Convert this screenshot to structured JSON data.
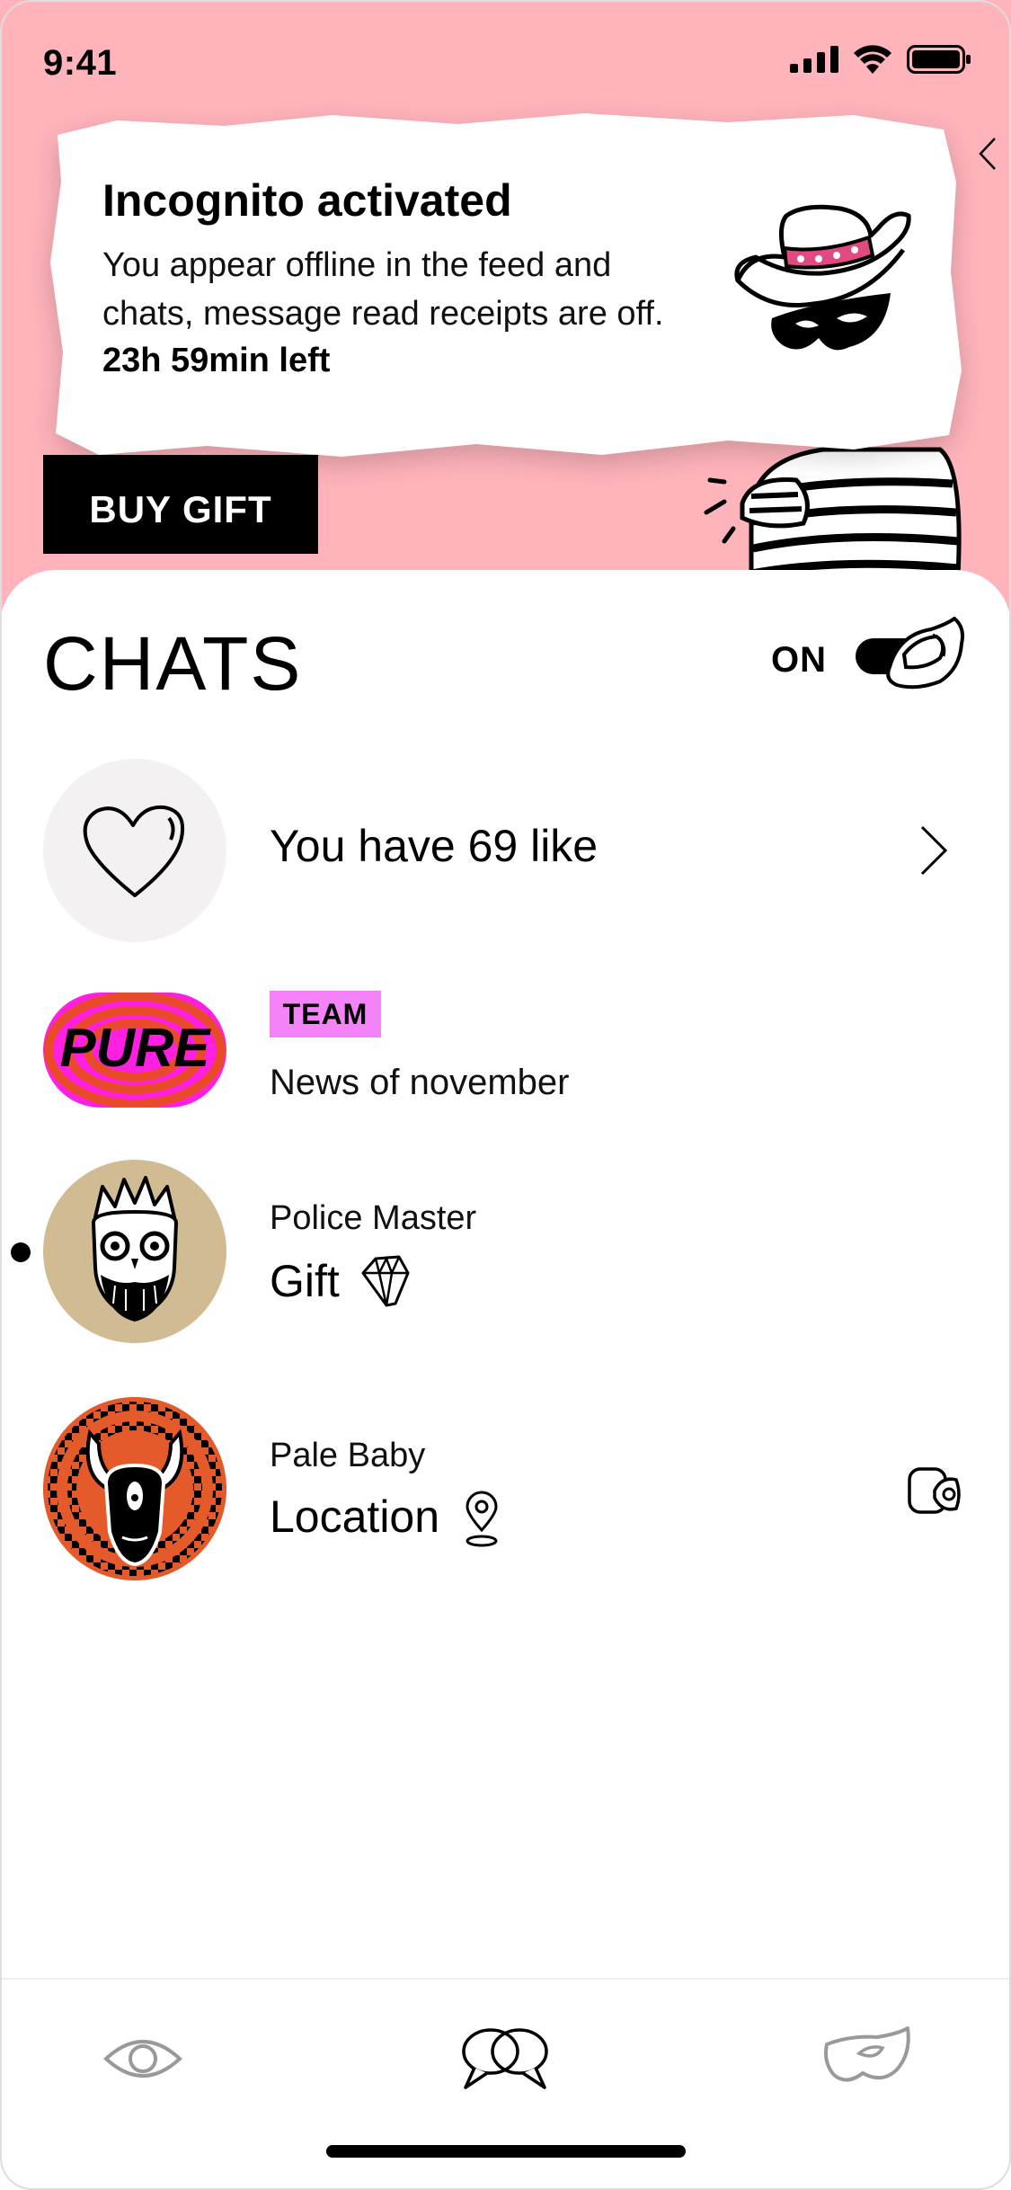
{
  "status_bar": {
    "time": "9:41"
  },
  "toast": {
    "title": "Incognito activated",
    "text": "You appear offline in the feed and chats, message read receipts are off.",
    "time_left": "23h 59min left",
    "icon": "cowboy-hat-mask-icon"
  },
  "hero": {
    "gift_button": "BUY GIFT"
  },
  "chats": {
    "title": "CHATS",
    "toggle_label": "ON",
    "toggle_on": true,
    "likes_row": {
      "text": "You have 69 like",
      "icon": "heart-icon"
    },
    "rows": [
      {
        "badge": "TEAM",
        "message": "News of november",
        "avatar_text": "PURE"
      },
      {
        "name": "Police Master",
        "message": "Gift",
        "unread": true,
        "icon": "diamond-icon"
      },
      {
        "name": "Pale Baby",
        "message": "Location",
        "icon": "location-pin-icon"
      }
    ]
  },
  "colors": {
    "hero_bg": "#ffb3bb",
    "badge": "#f383f6",
    "avatar_tan": "#d1bb92",
    "avatar_orange": "#e45a2a"
  },
  "tabbar": {
    "items": [
      "eye-icon",
      "chat-bubbles-icon",
      "mask-icon"
    ]
  }
}
